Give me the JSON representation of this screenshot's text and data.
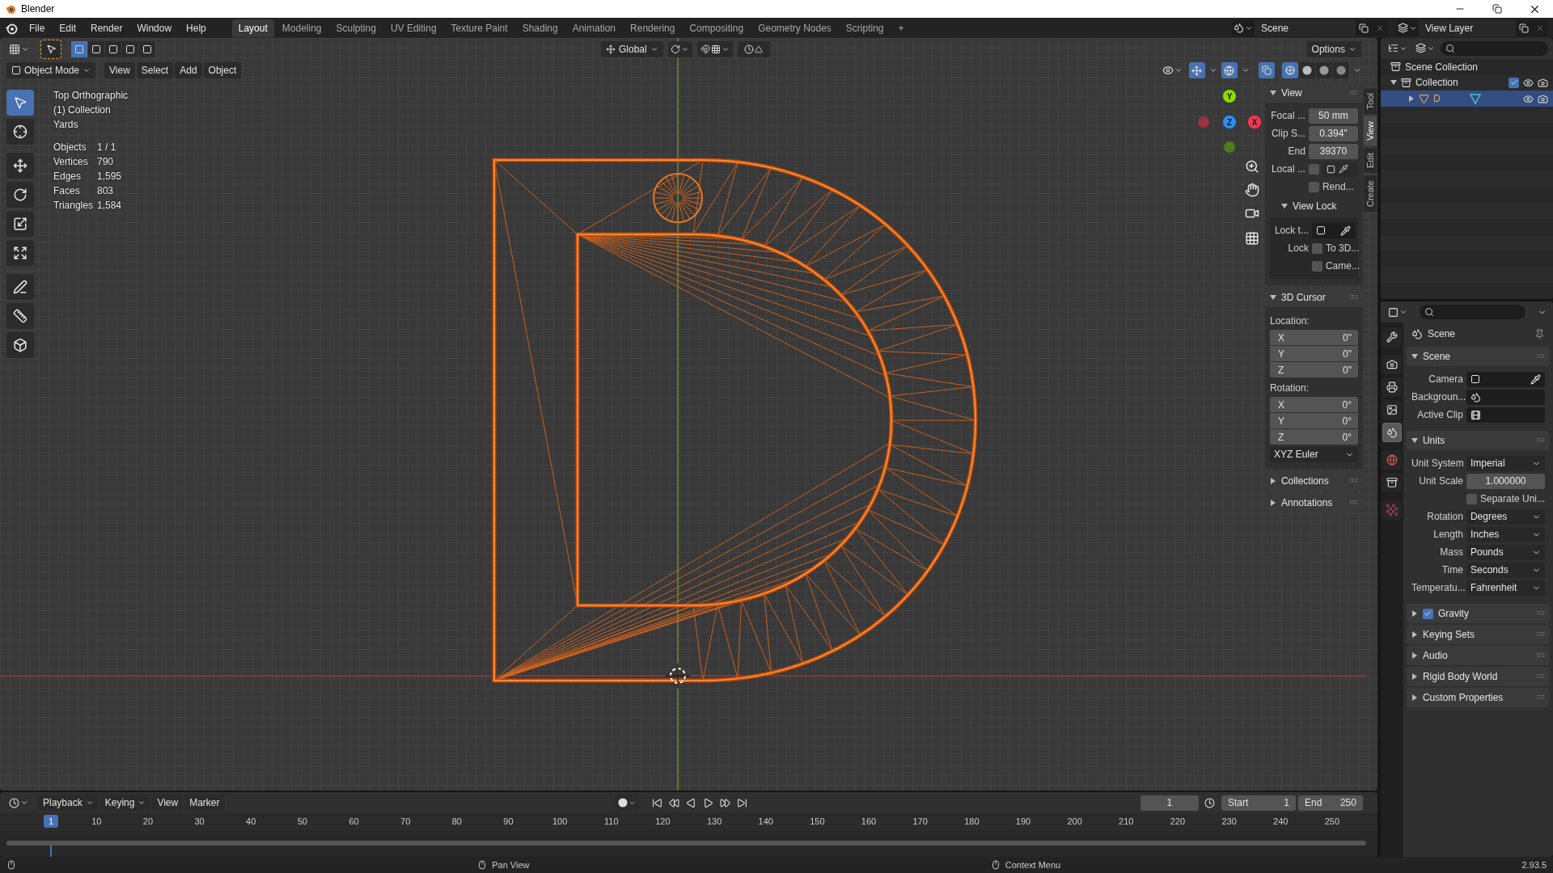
{
  "window": {
    "title": "Blender"
  },
  "menus": [
    "File",
    "Edit",
    "Render",
    "Window",
    "Help"
  ],
  "workspaces": [
    {
      "label": "Layout",
      "selected": true
    },
    {
      "label": "Modeling",
      "selected": false
    },
    {
      "label": "Sculpting",
      "selected": false
    },
    {
      "label": "UV Editing",
      "selected": false
    },
    {
      "label": "Texture Paint",
      "selected": false
    },
    {
      "label": "Shading",
      "selected": false
    },
    {
      "label": "Animation",
      "selected": false
    },
    {
      "label": "Rendering",
      "selected": false
    },
    {
      "label": "Compositing",
      "selected": false
    },
    {
      "label": "Geometry Nodes",
      "selected": false
    },
    {
      "label": "Scripting",
      "selected": false
    }
  ],
  "add_workspace": "+",
  "scene": "Scene",
  "view_layer": "View Layer",
  "tool_header": {
    "orientation": "Global",
    "options": "Options",
    "select_modes": [
      {
        "selected": true
      },
      {
        "selected": false
      },
      {
        "selected": false
      },
      {
        "selected": false
      },
      {
        "selected": false
      }
    ]
  },
  "viewport_header": {
    "mode": "Object Mode",
    "menus": [
      "View",
      "Select",
      "Add",
      "Object"
    ],
    "gizmos": true,
    "overlays": true,
    "xray": true,
    "shading": [
      {
        "kind": "wireframe",
        "selected": true
      },
      {
        "kind": "solid",
        "selected": false
      },
      {
        "kind": "material",
        "selected": false
      },
      {
        "kind": "rendered",
        "selected": false
      }
    ]
  },
  "viewport_info": {
    "lines": [
      "Top Orthographic",
      "(1) Collection",
      "Yards"
    ],
    "stats": [
      {
        "label": "Objects",
        "value": "1 / 1"
      },
      {
        "label": "Vertices",
        "value": "790"
      },
      {
        "label": "Edges",
        "value": "1,595"
      },
      {
        "label": "Faces",
        "value": "803"
      },
      {
        "label": "Triangles",
        "value": "1,584"
      }
    ]
  },
  "tools": [
    {
      "kind": "select",
      "selected": true
    },
    {
      "kind": "cursor",
      "selected": false
    },
    {
      "kind": "move",
      "selected": false
    },
    {
      "kind": "rotate",
      "selected": false
    },
    {
      "kind": "scale",
      "selected": false
    },
    {
      "kind": "transform",
      "selected": false
    },
    {
      "kind": "annotate",
      "selected": false
    },
    {
      "kind": "measure",
      "selected": false
    },
    {
      "kind": "add_cube",
      "selected": false
    }
  ],
  "gizmo": {
    "x": "X",
    "y": "Y",
    "z": "Z"
  },
  "sidebar": {
    "tabs": [
      {
        "label": "Tool",
        "selected": false
      },
      {
        "label": "View",
        "selected": true
      },
      {
        "label": "Edit",
        "selected": false
      },
      {
        "label": "Create",
        "selected": false
      }
    ],
    "panels": [
      {
        "title": "View",
        "expanded": true,
        "rows": [
          {
            "kind": "number",
            "label": "Focal ...",
            "value": "50 mm"
          },
          {
            "kind": "number",
            "label": "Clip S...",
            "value": "0.394\""
          },
          {
            "kind": "number",
            "label": "End",
            "value": "39370"
          },
          {
            "kind": "local",
            "label": "Local ...",
            "checked": false
          },
          {
            "kind": "checkbox",
            "text": "Rend...",
            "checked": false
          },
          {
            "kind": "subpanel",
            "title": "View Lock",
            "expanded": true,
            "rows": [
              {
                "kind": "object",
                "label": "Lock t..."
              },
              {
                "kind": "checkbox",
                "label": "Lock",
                "text": "To 3D...",
                "checked": false
              },
              {
                "kind": "checkbox",
                "text": "Came...",
                "checked": false
              }
            ]
          }
        ]
      },
      {
        "title": "3D Cursor",
        "expanded": true,
        "rows": [
          {
            "kind": "caption",
            "text": "Location:"
          },
          {
            "kind": "vector",
            "items": [
              {
                "axis": "X",
                "value": "0\""
              },
              {
                "axis": "Y",
                "value": "0\""
              },
              {
                "axis": "Z",
                "value": "0\""
              }
            ]
          },
          {
            "kind": "caption",
            "text": "Rotation:"
          },
          {
            "kind": "vector",
            "items": [
              {
                "axis": "X",
                "value": "0°"
              },
              {
                "axis": "Y",
                "value": "0°"
              },
              {
                "axis": "Z",
                "value": "0°"
              }
            ]
          },
          {
            "kind": "dropdown",
            "value": "XYZ Euler"
          }
        ]
      },
      {
        "title": "Collections",
        "expanded": false
      },
      {
        "title": "Annotations",
        "expanded": false
      }
    ]
  },
  "outliner": {
    "root": "Scene Collection",
    "collection": {
      "label": "Collection",
      "expanded": true,
      "checked": true,
      "children": [
        {
          "label": "D",
          "expanded": false,
          "selected": true
        }
      ]
    }
  },
  "properties": {
    "tabs": [
      {
        "kind": "tool",
        "selected": false
      },
      {
        "kind": "render",
        "selected": false
      },
      {
        "kind": "output",
        "selected": false
      },
      {
        "kind": "view_layer",
        "selected": false
      },
      {
        "kind": "scene",
        "selected": true
      },
      {
        "kind": "world",
        "selected": false
      },
      {
        "kind": "collection",
        "selected": false
      },
      {
        "kind": "texture",
        "selected": false
      }
    ],
    "context": "Scene",
    "panels": [
      {
        "title": "Scene",
        "expanded": true,
        "rows": [
          {
            "kind": "object",
            "label": "Camera"
          },
          {
            "kind": "scene",
            "label": "Backgroun..."
          },
          {
            "kind": "clip",
            "label": "Active Clip"
          }
        ]
      },
      {
        "title": "Units",
        "expanded": true,
        "rows": [
          {
            "kind": "dropdown",
            "label": "Unit System",
            "value": "Imperial"
          },
          {
            "kind": "number",
            "label": "Unit Scale",
            "value": "1.000000"
          },
          {
            "kind": "checkbox",
            "text": "Separate Uni...",
            "checked": false
          },
          {
            "kind": "dropdown",
            "label": "Rotation",
            "value": "Degrees"
          },
          {
            "kind": "dropdown",
            "label": "Length",
            "value": "Inches"
          },
          {
            "kind": "dropdown",
            "label": "Mass",
            "value": "Pounds"
          },
          {
            "kind": "dropdown",
            "label": "Time",
            "value": "Seconds"
          },
          {
            "kind": "dropdown",
            "label": "Temperatu...",
            "value": "Fahrenheit"
          }
        ]
      },
      {
        "title": "Gravity",
        "expanded": false,
        "kind": "toggle",
        "checked": true
      },
      {
        "title": "Keying Sets",
        "expanded": false
      },
      {
        "title": "Audio",
        "expanded": false
      },
      {
        "title": "Rigid Body World",
        "expanded": false
      },
      {
        "title": "Custom Properties",
        "expanded": false
      }
    ]
  },
  "timeline": {
    "menus": [
      {
        "label": "Playback",
        "dropdown": true
      },
      {
        "label": "Keying",
        "dropdown": true
      },
      {
        "label": "View",
        "dropdown": false
      },
      {
        "label": "Marker",
        "dropdown": false
      }
    ],
    "frame": "1",
    "start_label": "Start",
    "start": "1",
    "end_label": "End",
    "end": "250",
    "current": "1",
    "ticks": [
      "10",
      "20",
      "30",
      "40",
      "50",
      "60",
      "70",
      "80",
      "90",
      "100",
      "110",
      "120",
      "130",
      "140",
      "150",
      "160",
      "170",
      "180",
      "190",
      "200",
      "210",
      "220",
      "230",
      "240",
      "250"
    ]
  },
  "status_bar": {
    "hints": [
      "Pan View",
      "Context Menu"
    ],
    "version": "2.93.5"
  }
}
